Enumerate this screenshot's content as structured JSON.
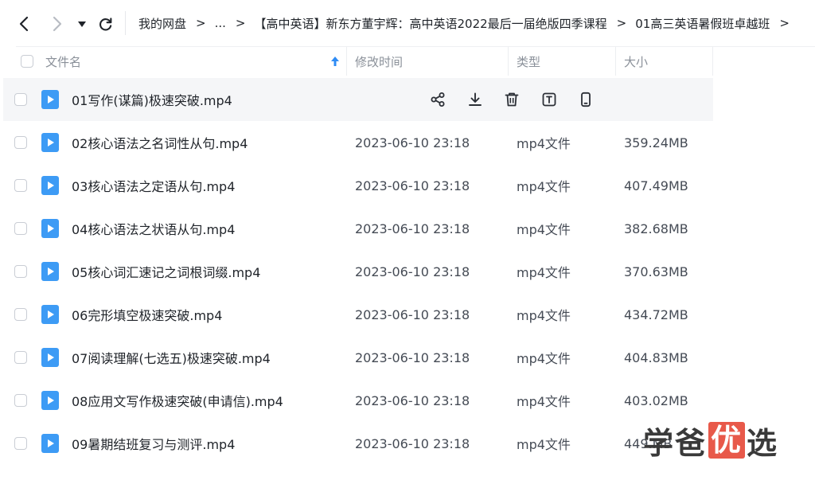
{
  "breadcrumb": [
    {
      "label": "我的网盘"
    },
    {
      "label": "..."
    },
    {
      "label": "【高中英语】新东方董宇辉：高中英语2022最后一届绝版四季课程"
    },
    {
      "label": "01高三英语暑假班卓越班"
    }
  ],
  "columns": {
    "name": "文件名",
    "modified": "修改时间",
    "type": "类型",
    "size": "大小"
  },
  "files": [
    {
      "name": "01写作(谋篇)极速突破.mp4",
      "modified": "",
      "type": "",
      "size": ""
    },
    {
      "name": "02核心语法之名词性从句.mp4",
      "modified": "2023-06-10 23:18",
      "type": "mp4文件",
      "size": "359.24MB"
    },
    {
      "name": "03核心语法之定语从句.mp4",
      "modified": "2023-06-10 23:18",
      "type": "mp4文件",
      "size": "407.49MB"
    },
    {
      "name": "04核心语法之状语从句.mp4",
      "modified": "2023-06-10 23:18",
      "type": "mp4文件",
      "size": "382.68MB"
    },
    {
      "name": "05核心词汇速记之词根词缀.mp4",
      "modified": "2023-06-10 23:18",
      "type": "mp4文件",
      "size": "370.63MB"
    },
    {
      "name": "06完形填空极速突破.mp4",
      "modified": "2023-06-10 23:18",
      "type": "mp4文件",
      "size": "434.72MB"
    },
    {
      "name": "07阅读理解(七选五)极速突破.mp4",
      "modified": "2023-06-10 23:18",
      "type": "mp4文件",
      "size": "404.83MB"
    },
    {
      "name": "08应用文写作极速突破(申请信).mp4",
      "modified": "2023-06-10 23:18",
      "type": "mp4文件",
      "size": "403.02MB"
    },
    {
      "name": "09暑期结班复习与测评.mp4",
      "modified": "2023-06-10 23:18",
      "type": "mp4文件",
      "size": "449.MB"
    }
  ],
  "hover_actions": [
    "share-icon",
    "download-icon",
    "delete-icon",
    "rename-icon",
    "phone-icon"
  ],
  "watermark": {
    "part1": "学爸",
    "part2": "优",
    "part3": "选"
  },
  "colors": {
    "accent": "#2f8cf5",
    "file_icon": "#3d9bf5",
    "hover_row": "#f5f6f8",
    "watermark_red": "#e8594a"
  }
}
